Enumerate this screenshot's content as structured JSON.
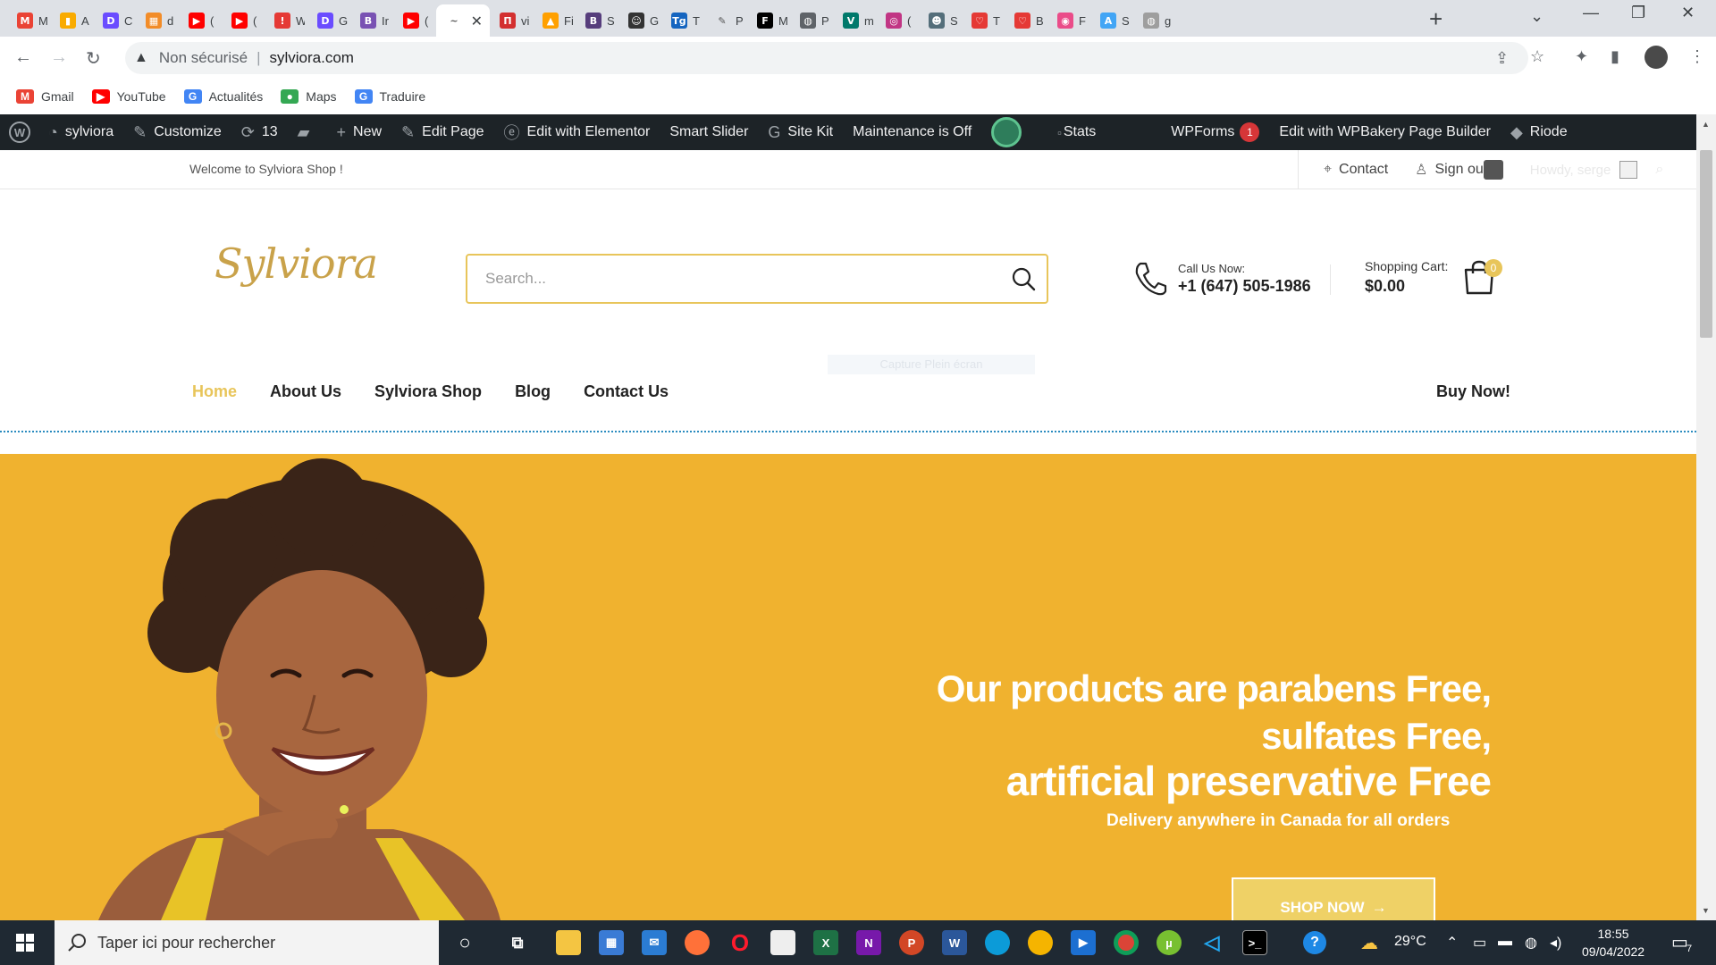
{
  "browser": {
    "tabs": [
      {
        "title": "M",
        "icon": "gmail-icon",
        "color": "#ea4335",
        "glyph": "M"
      },
      {
        "title": "A",
        "icon": "analytics-icon",
        "color": "#f9ab00",
        "glyph": "▮"
      },
      {
        "title": "C",
        "icon": "app-c-icon",
        "color": "#6a4cff",
        "glyph": "D"
      },
      {
        "title": "d",
        "icon": "app-d-icon",
        "color": "#f28c28",
        "glyph": "▦"
      },
      {
        "title": "(",
        "icon": "youtube-icon",
        "color": "#ff0000",
        "glyph": "▶"
      },
      {
        "title": "(",
        "icon": "youtube-icon",
        "color": "#ff0000",
        "glyph": "▶"
      },
      {
        "title": "W",
        "icon": "app-w-icon",
        "color": "#e53935",
        "glyph": "!"
      },
      {
        "title": "G",
        "icon": "app-g-icon",
        "color": "#6a4cff",
        "glyph": "D"
      },
      {
        "title": "Ir",
        "icon": "bootstrap-icon",
        "color": "#7952b3",
        "glyph": "B"
      },
      {
        "title": "(",
        "icon": "youtube-icon",
        "color": "#ff0000",
        "glyph": "▶"
      },
      {
        "title": "",
        "icon": "sylviora-icon",
        "color": "#ffffff",
        "glyph": "~",
        "active": true
      },
      {
        "title": "vi",
        "icon": "app-vi-icon",
        "color": "#d32f2f",
        "glyph": "П"
      },
      {
        "title": "Fi",
        "icon": "firebase-icon",
        "color": "#ffa000",
        "glyph": "▲"
      },
      {
        "title": "S",
        "icon": "bootstrap-icon",
        "color": "#563d7c",
        "glyph": "B"
      },
      {
        "title": "G",
        "icon": "app-g2-icon",
        "color": "#333333",
        "glyph": "☺"
      },
      {
        "title": "T",
        "icon": "app-tg-icon",
        "color": "#1565c0",
        "glyph": "Tg"
      },
      {
        "title": "P",
        "icon": "pen-icon",
        "color": "#dee1e6",
        "glyph": "✎"
      },
      {
        "title": "M",
        "icon": "flo-icon",
        "color": "#000000",
        "glyph": "F"
      },
      {
        "title": "P",
        "icon": "globe-icon",
        "color": "#5f6368",
        "glyph": "◍"
      },
      {
        "title": "m",
        "icon": "vue-icon",
        "color": "#00796b",
        "glyph": "V"
      },
      {
        "title": "(",
        "icon": "instagram-icon",
        "color": "#c13584",
        "glyph": "◎"
      },
      {
        "title": "S",
        "icon": "avatar-icon",
        "color": "#546e7a",
        "glyph": "☻"
      },
      {
        "title": "T",
        "icon": "chat-icon",
        "color": "#e53935",
        "glyph": "♡"
      },
      {
        "title": "B",
        "icon": "chat2-icon",
        "color": "#e53935",
        "glyph": "♡"
      },
      {
        "title": "F",
        "icon": "dribbble-icon",
        "color": "#ea4c89",
        "glyph": "◉"
      },
      {
        "title": "S",
        "icon": "app-s-icon",
        "color": "#42a5f5",
        "glyph": "A"
      },
      {
        "title": "g",
        "icon": "globe-icon",
        "color": "#9e9e9e",
        "glyph": "◍"
      }
    ],
    "address": {
      "security": "Non sécurisé",
      "url": "sylviora.com"
    },
    "bookmarks": [
      {
        "label": "Gmail",
        "icon": "gmail-icon",
        "color": "#ea4335",
        "glyph": "M"
      },
      {
        "label": "YouTube",
        "icon": "youtube-icon",
        "color": "#ff0000",
        "glyph": "▶"
      },
      {
        "label": "Actualités",
        "icon": "news-icon",
        "color": "#4285f4",
        "glyph": "G"
      },
      {
        "label": "Maps",
        "icon": "maps-icon",
        "color": "#34a853",
        "glyph": "●"
      },
      {
        "label": "Traduire",
        "icon": "translate-icon",
        "color": "#4285f4",
        "glyph": "G"
      }
    ]
  },
  "wpbar": {
    "site": "sylviora",
    "customize": "Customize",
    "updates": "13",
    "new": "New",
    "edit_page": "Edit Page",
    "elementor": "Edit with Elementor",
    "smart_slider": "Smart Slider",
    "site_kit": "Site Kit",
    "maintenance": "Maintenance is Off",
    "stats": "Stats",
    "wpforms": "WPForms",
    "wpforms_badge": "1",
    "wpbakery": "Edit with WPBakery Page Builder",
    "riode": "Riode"
  },
  "site": {
    "welcome": "Welcome to Sylviora Shop !",
    "contact": "Contact",
    "signout": "Sign ou",
    "howdy": "Howdy, serge",
    "logo": "Sylviora",
    "search_placeholder": "Search...",
    "call_label": "Call Us Now:",
    "call_number": "+1 (647) 505-1986",
    "cart_label": "Shopping Cart:",
    "cart_amount": "$0.00",
    "cart_count": "0",
    "ghost_text": "Capture Plein écran",
    "nav": [
      "Home",
      "About Us",
      "Sylviora Shop",
      "Blog",
      "Contact Us"
    ],
    "buy_now": "Buy Now!",
    "brand_color": "#e8c55a",
    "hero": {
      "line1": "Our products are parabens Free,",
      "line2": "sulfates Free,",
      "line3": "artificial preservative Free",
      "sub": "Delivery anywhere in Canada for all orders",
      "button": "SHOP NOW",
      "bg": "#f0b22f"
    }
  },
  "taskbar": {
    "search": "Taper ici pour rechercher",
    "weather": "29°C",
    "time": "18:55",
    "date": "09/04/2022",
    "notif": "7"
  }
}
